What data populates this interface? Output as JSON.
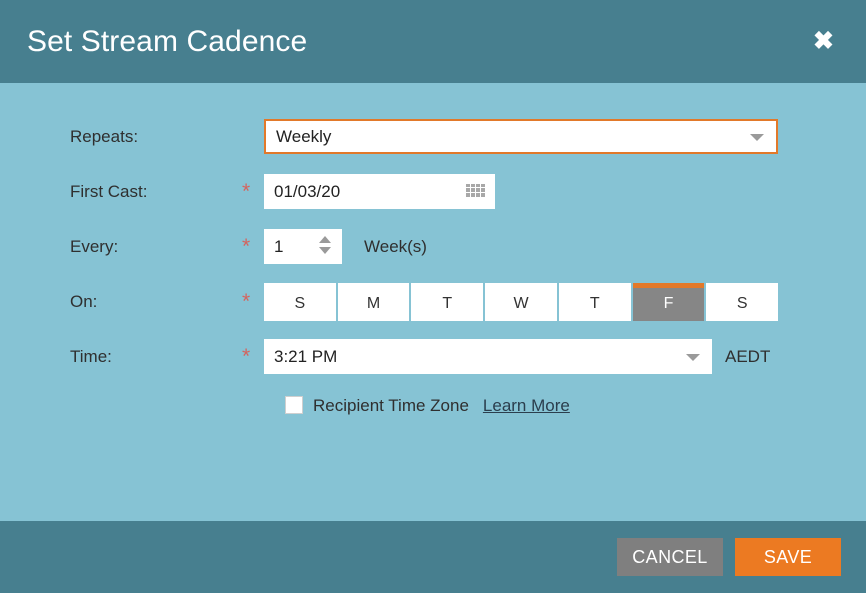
{
  "header": {
    "title": "Set Stream Cadence",
    "close_label": "✖"
  },
  "form": {
    "repeats": {
      "label": "Repeats:",
      "value": "Weekly",
      "required": false
    },
    "first_cast": {
      "label": "First Cast:",
      "value": "01/03/20",
      "required": true,
      "required_marker": "*"
    },
    "every": {
      "label": "Every:",
      "value": "1",
      "unit": "Week(s)",
      "required": true,
      "required_marker": "*"
    },
    "on": {
      "label": "On:",
      "required": true,
      "required_marker": "*",
      "days": [
        {
          "label": "S",
          "name": "sunday",
          "selected": false
        },
        {
          "label": "M",
          "name": "monday",
          "selected": false
        },
        {
          "label": "T",
          "name": "tuesday",
          "selected": false
        },
        {
          "label": "W",
          "name": "wednesday",
          "selected": false
        },
        {
          "label": "T",
          "name": "thursday",
          "selected": false
        },
        {
          "label": "F",
          "name": "friday",
          "selected": true
        },
        {
          "label": "S",
          "name": "saturday",
          "selected": false
        }
      ]
    },
    "time": {
      "label": "Time:",
      "value": "3:21 PM",
      "timezone": "AEDT",
      "required": true,
      "required_marker": "*"
    },
    "recipient_time_zone": {
      "label": "Recipient Time Zone",
      "checked": false,
      "learn_more": "Learn More"
    }
  },
  "footer": {
    "cancel_label": "CANCEL",
    "save_label": "SAVE"
  },
  "colors": {
    "header_bg": "#477f8f",
    "body_bg": "#86c3d4",
    "accent_orange": "#e2792a",
    "save_orange": "#ec7a22",
    "cancel_gray": "#7f7f7f",
    "selected_day_gray": "#868686",
    "required_red": "#d4645e",
    "link_navy": "#2b3e4d"
  }
}
